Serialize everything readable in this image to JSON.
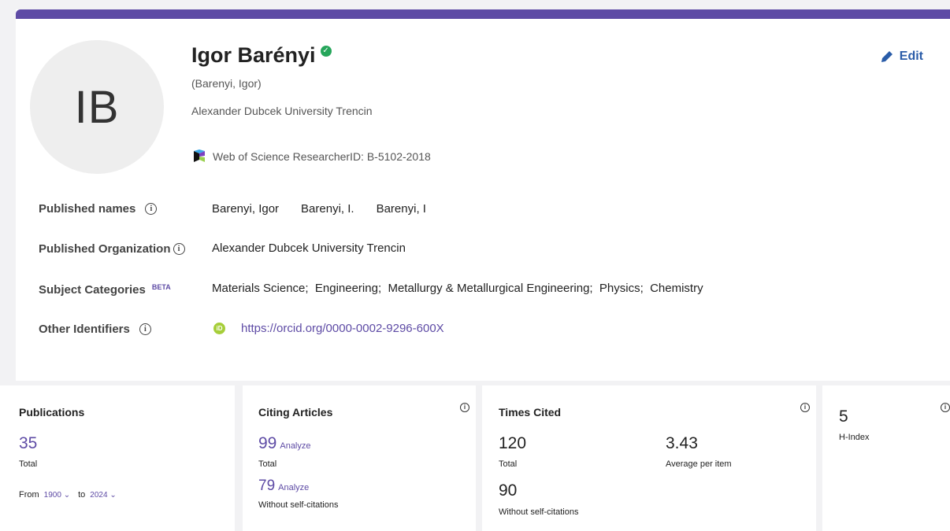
{
  "profile": {
    "initials": "IB",
    "name": "Igor Barényi",
    "alt_name": "(Barenyi, Igor)",
    "affiliation": "Alexander Dubcek University Trencin",
    "researcher_id": "Web of Science ResearcherID: B-5102-2018",
    "edit_label": "Edit"
  },
  "fields": {
    "published_names": {
      "label": "Published names",
      "values": [
        "Barenyi, Igor",
        "Barenyi, I.",
        "Barenyi, I"
      ]
    },
    "published_org": {
      "label": "Published Organization",
      "value": "Alexander Dubcek University Trencin"
    },
    "subject_categories": {
      "label": "Subject Categories",
      "beta": "BETA",
      "value": "Materials Science;  Engineering;  Metallurgy & Metallurgical Engineering;  Physics;  Chemistry"
    },
    "other_identifiers": {
      "label": "Other Identifiers",
      "orcid_badge": "iD",
      "orcid_url": "https://orcid.org/0000-0002-9296-600X"
    }
  },
  "metrics": {
    "publications": {
      "title": "Publications",
      "total": "35",
      "total_label": "Total",
      "from_label": "From",
      "from_year": "1900",
      "to_label": "to",
      "to_year": "2024"
    },
    "citing": {
      "title": "Citing Articles",
      "total": "99",
      "total_label": "Total",
      "without_self": "79",
      "without_self_label": "Without self-citations",
      "analyze_label": "Analyze"
    },
    "times_cited": {
      "title": "Times Cited",
      "total": "120",
      "total_label": "Total",
      "average": "3.43",
      "average_label": "Average per item",
      "without_self": "90",
      "without_self_label": "Without self-citations"
    },
    "h_index": {
      "value": "5",
      "label": "H-Index"
    }
  },
  "colors": {
    "accent": "#5e4ba5",
    "edit_blue": "#2a5ca8",
    "verified_green": "#26a65b",
    "orcid_green": "#a6ce39"
  }
}
